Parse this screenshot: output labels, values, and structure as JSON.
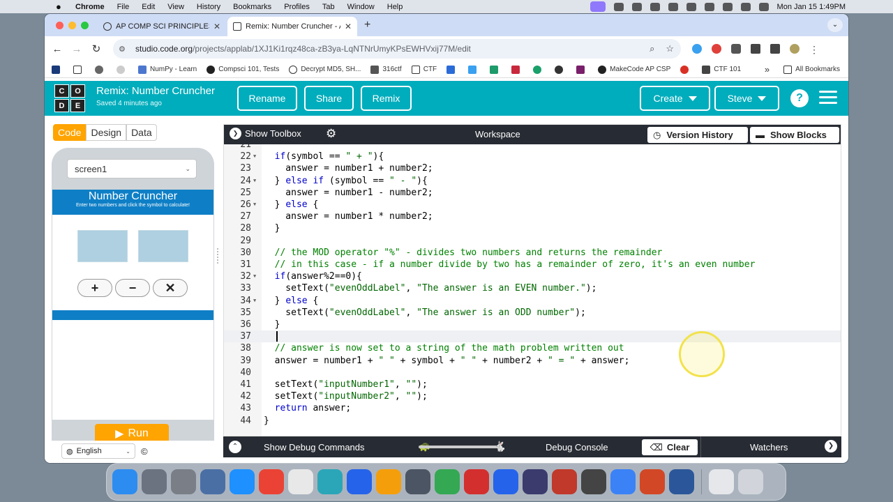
{
  "menubar": {
    "app": "Chrome",
    "items": [
      "File",
      "Edit",
      "View",
      "History",
      "Bookmarks",
      "Profiles",
      "Tab",
      "Window",
      "Help"
    ],
    "datetime": "Mon Jan 15  1:49PM"
  },
  "tabs": [
    {
      "label": "AP COMP SCI PRINCIPLES (S"
    },
    {
      "label": "Remix: Number Cruncher - A"
    }
  ],
  "address": {
    "host": "studio.code.org",
    "path": "/projects/applab/1XJ1Ki1rqz48ca-zB3ya-LqNTNrUmyKPsEWHVxij77M/edit"
  },
  "bookmarks": [
    "NumPy - Learn",
    "Compsci 101, Tests",
    "Decrypt MD5, SH...",
    "316ctf",
    "CTF",
    "MakeCode AP CSP",
    "CTF 101"
  ],
  "bookmarks_more": "»",
  "all_bookmarks": "All Bookmarks",
  "header": {
    "logo": [
      "C",
      "O",
      "D",
      "E"
    ],
    "title": "Remix: Number Cruncher",
    "saved": "Saved 4 minutes ago",
    "rename": "Rename",
    "share": "Share",
    "remix": "Remix",
    "create": "Create",
    "user": "Steve",
    "help": "?"
  },
  "modes": [
    "Code",
    "Design",
    "Data"
  ],
  "screen_select": "screen1",
  "app": {
    "title": "Number Cruncher",
    "subtitle": "Enter two numbers and click the symbol to calculate!",
    "ops": [
      "+",
      "−",
      "✕"
    ],
    "run": "Run"
  },
  "language": "English",
  "copyright": "©",
  "workspace": {
    "toolbox": "Show Toolbox",
    "title": "Workspace",
    "version_history": "Version History",
    "show_blocks": "Show Blocks"
  },
  "code_lines": [
    {
      "n": "21",
      "text": ""
    },
    {
      "n": "22",
      "fold": true,
      "text": "  if(symbol == \" + \"){"
    },
    {
      "n": "23",
      "text": "    answer = number1 + number2;"
    },
    {
      "n": "24",
      "fold": true,
      "text": "  } else if (symbol == \" - \"){"
    },
    {
      "n": "25",
      "text": "    answer = number1 - number2;"
    },
    {
      "n": "26",
      "fold": true,
      "text": "  } else {"
    },
    {
      "n": "27",
      "text": "    answer = number1 * number2;"
    },
    {
      "n": "28",
      "text": "  }"
    },
    {
      "n": "29",
      "text": ""
    },
    {
      "n": "30",
      "text": "  // the MOD operator \"%\" - divides two numbers and returns the remainder"
    },
    {
      "n": "31",
      "text": "  // in this case - if a number divide by two has a remainder of zero, it's an even number"
    },
    {
      "n": "32",
      "fold": true,
      "text": "  if(answer%2==0){"
    },
    {
      "n": "33",
      "text": "    setText(\"evenOddLabel\", \"The answer is an EVEN number.\");"
    },
    {
      "n": "34",
      "fold": true,
      "text": "  } else {"
    },
    {
      "n": "35",
      "text": "    setText(\"evenOddLabel\", \"The answer is an ODD number\");"
    },
    {
      "n": "36",
      "text": "  }"
    },
    {
      "n": "37",
      "text": "",
      "current": true
    },
    {
      "n": "38",
      "text": "  // answer is now set to a string of the math problem written out"
    },
    {
      "n": "39",
      "text": "  answer = number1 + \" \" + symbol + \" \" + number2 + \" = \" + answer;"
    },
    {
      "n": "40",
      "text": ""
    },
    {
      "n": "41",
      "text": "  setText(\"inputNumber1\", \"\");"
    },
    {
      "n": "42",
      "text": "  setText(\"inputNumber2\", \"\");"
    },
    {
      "n": "43",
      "text": "  return answer;"
    },
    {
      "n": "44",
      "text": "}"
    }
  ],
  "debug": {
    "commands": "Show Debug Commands",
    "console": "Debug Console",
    "clear": "Clear",
    "watchers": "Watchers"
  },
  "colors": {
    "header_teal": "#00adbc",
    "code_orange": "#ffa400",
    "workspace_dark": "#272b33",
    "app_blue": "#0e7fc6"
  },
  "dock_icons": [
    "finder-icon",
    "launchpad-icon",
    "system-settings-icon",
    "preview-icon",
    "safari-icon",
    "chrome-icon",
    "textedit-icon",
    "geogebra-icon",
    "code-icon",
    "books-icon",
    "calculator-icon",
    "drive-icon",
    "acrobat-icon",
    "pen-icon",
    "vpn-icon",
    "flag-icon",
    "unity-icon",
    "spark-icon",
    "powerpoint-icon",
    "word-icon",
    "documents-icon",
    "trash-icon"
  ]
}
